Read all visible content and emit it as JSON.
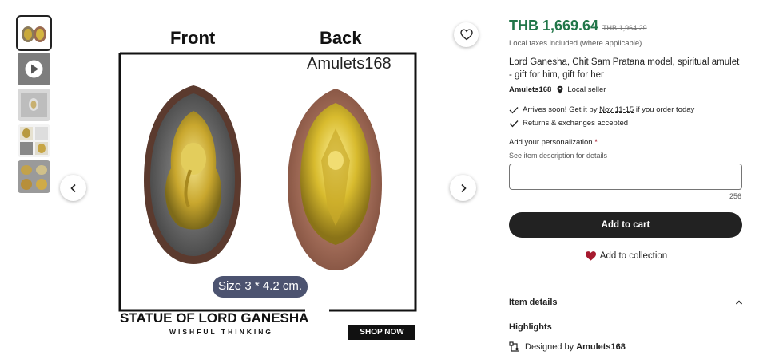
{
  "product": {
    "price": "THB 1,669.64",
    "original_price": "THB 1,964.29",
    "taxes_note": "Local taxes included (where applicable)",
    "title": "Lord Ganesha, Chit Sam Pratana model, spiritual amulet - gift for him, gift for her",
    "seller_name": "Amulets168",
    "local_seller_label": "Local seller"
  },
  "shipping": {
    "arrival_prefix": "Arrives soon! Get it by ",
    "arrival_dates": "Nov 11-15",
    "arrival_suffix": " if you order today",
    "returns": "Returns & exchanges accepted"
  },
  "personalization": {
    "label": "Add your personalization",
    "required_mark": "*",
    "hint": "See item description for details",
    "value": "",
    "counter": "256"
  },
  "actions": {
    "add_to_cart": "Add to cart",
    "add_to_collection": "Add to collection"
  },
  "details": {
    "item_details": "Item details",
    "highlights": "Highlights",
    "designed_by_prefix": "Designed by",
    "designed_by_name": "Amulets168"
  },
  "image": {
    "front_label": "Front",
    "back_label": "Back",
    "watermark": "Amulets168",
    "size_label": "Size 3 * 4.2 cm.",
    "headline": "STATUE OF LORD GANESHA",
    "tagline": "WISHFUL THINKING",
    "cta": "SHOP NOW"
  },
  "colors": {
    "price_green": "#217649",
    "heart_red": "#a61a2e",
    "button_dark": "#222222"
  },
  "icons": [
    "heart-icon",
    "play-icon",
    "chevron-left-icon",
    "chevron-right-icon",
    "location-pin-icon",
    "check-icon",
    "chevron-up-icon",
    "designer-icon"
  ]
}
